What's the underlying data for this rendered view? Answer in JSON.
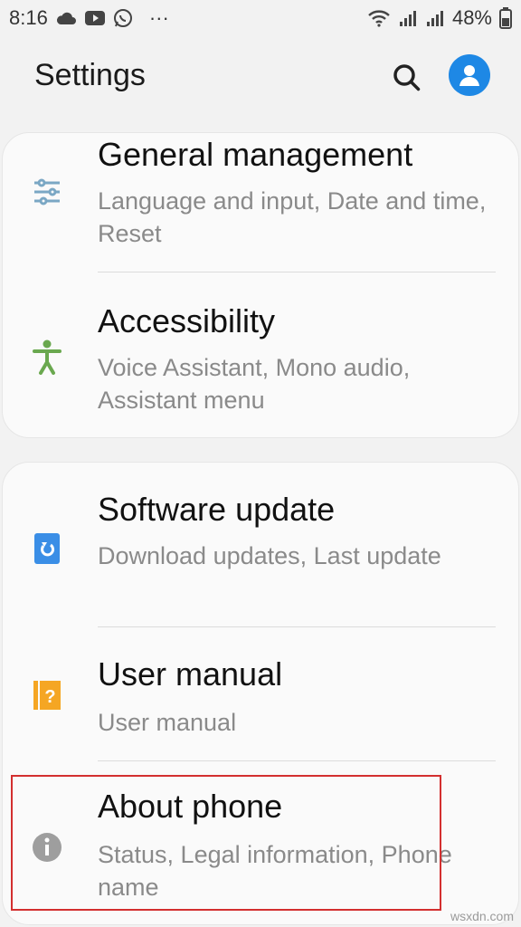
{
  "status_bar": {
    "time": "8:16",
    "more": "···",
    "battery": "48%"
  },
  "header": {
    "title": "Settings"
  },
  "items": [
    {
      "title": "General management",
      "subtitle": "Language and input, Date and time, Reset",
      "icon": "sliders-icon",
      "icon_color": "#7aa7c4"
    },
    {
      "title": "Accessibility",
      "subtitle": "Voice Assistant, Mono audio, Assistant menu",
      "icon": "accessibility-person-icon",
      "icon_color": "#6aa84f"
    },
    {
      "title": "Software update",
      "subtitle": "Download updates, Last update",
      "icon": "software-update-icon",
      "icon_color": "#3a8ee6"
    },
    {
      "title": "User manual",
      "subtitle": "User manual",
      "icon": "help-book-icon",
      "icon_color": "#f5a623"
    },
    {
      "title": "About phone",
      "subtitle": "Status, Legal information, Phone name",
      "icon": "info-icon",
      "icon_color": "#9e9e9e"
    }
  ],
  "watermark": "wsxdn.com",
  "colors": {
    "accent": "#1e88e5",
    "highlight": "#d32f2f"
  }
}
